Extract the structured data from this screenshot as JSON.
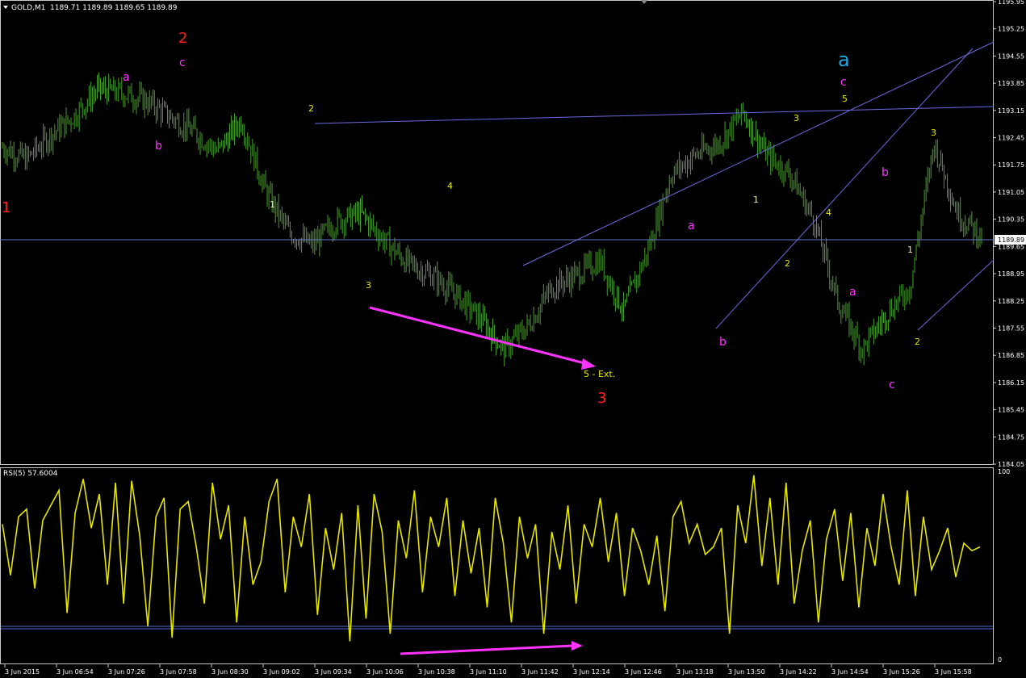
{
  "window": {
    "symbol_label": "GOLD,M1",
    "ohlc_label": "1189.71 1189.89 1189.65 1189.89",
    "indicator_label": "RSI(5) 57.6004"
  },
  "colors": {
    "background": "#000000",
    "frame": "#ffffff",
    "bars": "#4a9e2e",
    "trendline": "#6a6adf",
    "price_line": "#6a7acc",
    "rsi_line": "#e6e600",
    "rsi_level": "#4b6bd8",
    "count_yellow": "#e6e600",
    "count_magenta": "#ff33ff",
    "count_red": "#ff2222",
    "count_cyan": "#22a7e6",
    "count_white": "#e6e6b0",
    "arrow": "#ff33ff"
  },
  "price_axis": {
    "labels": [
      "1195.95",
      "1195.25",
      "1194.55",
      "1193.85",
      "1193.15",
      "1192.45",
      "1191.75",
      "1191.05",
      "1190.35",
      "1189.65",
      "1188.95",
      "1188.25",
      "1187.55",
      "1186.85",
      "1186.15",
      "1185.45",
      "1184.75",
      "1184.05"
    ],
    "current_price": "1189.89"
  },
  "rsi_axis": {
    "top": "100",
    "bottom": "0",
    "levels": [
      15,
      18
    ]
  },
  "time_axis": {
    "labels": [
      "3 Jun 2015",
      "3 Jun 06:54",
      "3 Jun 07:26",
      "3 Jun 07:58",
      "3 Jun 08:30",
      "3 Jun 09:02",
      "3 Jun 09:34",
      "3 Jun 10:06",
      "3 Jun 10:38",
      "3 Jun 11:10",
      "3 Jun 11:42",
      "3 Jun 12:14",
      "3 Jun 12:46",
      "3 Jun 13:18",
      "3 Jun 13:50",
      "3 Jun 14:22",
      "3 Jun 14:54",
      "3 Jun 15:26",
      "3 Jun 15:58"
    ]
  },
  "chart_data": [
    {
      "type": "line",
      "title": "GOLD,M1",
      "ylim": [
        1184.05,
        1195.95
      ],
      "x": [
        "06:22",
        "06:54",
        "07:10",
        "07:26",
        "07:42",
        "07:58",
        "08:14",
        "08:30",
        "08:46",
        "09:02",
        "09:18",
        "09:34",
        "09:50",
        "10:06",
        "10:22",
        "10:38",
        "10:54",
        "11:10",
        "11:26",
        "11:42",
        "11:58",
        "12:14",
        "12:30",
        "12:46",
        "13:02",
        "13:18",
        "13:34",
        "13:50",
        "14:06",
        "14:22",
        "14:38",
        "14:54",
        "15:02",
        "15:10",
        "15:18",
        "15:26",
        "15:34",
        "15:42",
        "15:50",
        "15:58",
        "16:06",
        "16:14"
      ],
      "series": [
        {
          "values": [
            1192.2,
            1191.9,
            1192.5,
            1193.0,
            1193.7,
            1193.6,
            1193.4,
            1193.0,
            1192.6,
            1192.1,
            1192.9,
            1191.1,
            1190.0,
            1189.7,
            1190.3,
            1190.5,
            1189.8,
            1189.2,
            1188.9,
            1188.4,
            1187.8,
            1187.0,
            1187.6,
            1188.6,
            1188.9,
            1189.3,
            1188.0,
            1189.5,
            1191.5,
            1192.0,
            1192.3,
            1193.1,
            1192.0,
            1191.5,
            1190.3,
            1188.2,
            1187.0,
            1187.9,
            1188.6,
            1192.3,
            1190.5,
            1189.9
          ]
        }
      ],
      "annotations": [
        {
          "text": "1",
          "x": "06:22",
          "y": 1190.5,
          "color": "red"
        },
        {
          "text": "2",
          "x": "07:58",
          "y": 1195.0,
          "color": "red"
        },
        {
          "text": "c",
          "x": "07:58",
          "y": 1194.5,
          "color": "magenta"
        },
        {
          "text": "a",
          "x": "07:42",
          "y": 1194.0,
          "color": "magenta"
        },
        {
          "text": "b",
          "x": "08:30",
          "y": 1192.3,
          "color": "magenta"
        },
        {
          "text": "1",
          "x": "09:18",
          "y": 1190.8,
          "color": "white"
        },
        {
          "text": "2",
          "x": "09:34",
          "y": 1193.4,
          "color": "yellow"
        },
        {
          "text": "3",
          "x": "10:06",
          "y": 1188.6,
          "color": "yellow"
        },
        {
          "text": "4",
          "x": "11:10",
          "y": 1191.4,
          "color": "yellow"
        },
        {
          "text": "5 - Ext.",
          "x": "12:14",
          "y": 1186.5,
          "color": "yellow"
        },
        {
          "text": "3",
          "x": "12:14",
          "y": 1185.9,
          "color": "red"
        },
        {
          "text": "a",
          "x": "13:18",
          "y": 1189.9,
          "color": "magenta"
        },
        {
          "text": "b",
          "x": "13:34",
          "y": 1187.2,
          "color": "magenta"
        },
        {
          "text": "1",
          "x": "13:50",
          "y": 1190.9,
          "color": "white"
        },
        {
          "text": "2",
          "x": "14:06",
          "y": 1188.9,
          "color": "yellow"
        },
        {
          "text": "3",
          "x": "14:22",
          "y": 1193.0,
          "color": "yellow"
        },
        {
          "text": "4",
          "x": "14:38",
          "y": 1190.6,
          "color": "yellow"
        },
        {
          "text": "5",
          "x": "14:54",
          "y": 1193.6,
          "color": "yellow"
        },
        {
          "text": "c",
          "x": "14:54",
          "y": 1193.9,
          "color": "magenta"
        },
        {
          "text": "a",
          "x": "14:54",
          "y": 1194.4,
          "color": "cyan"
        },
        {
          "text": "b",
          "x": "15:26",
          "y": 1191.7,
          "color": "magenta"
        },
        {
          "text": "a",
          "x": "14:54",
          "y": 1188.6,
          "color": "magenta"
        },
        {
          "text": "c",
          "x": "15:26",
          "y": 1186.3,
          "color": "magenta"
        },
        {
          "text": "1",
          "x": "15:34",
          "y": 1189.6,
          "color": "white"
        },
        {
          "text": "2",
          "x": "15:42",
          "y": 1187.3,
          "color": "yellow"
        },
        {
          "text": "3",
          "x": "15:58",
          "y": 1192.6,
          "color": "yellow"
        }
      ]
    },
    {
      "type": "line",
      "title": "RSI(5) 57.6004",
      "ylim": [
        0,
        100
      ],
      "series": [
        {
          "values": [
            72,
            45,
            76,
            80,
            38,
            74,
            82,
            90,
            25,
            78,
            96,
            70,
            88,
            40,
            94,
            30,
            95,
            66,
            18,
            76,
            86,
            12,
            80,
            84,
            60,
            30,
            94,
            64,
            82,
            20,
            76,
            40,
            52,
            84,
            96,
            36,
            76,
            60,
            88,
            24,
            70,
            48,
            78,
            10,
            82,
            22,
            88,
            68,
            14,
            74,
            54,
            90,
            36,
            76,
            60,
            86,
            34,
            74,
            46,
            70,
            28,
            86,
            62,
            20,
            76,
            54,
            72,
            14,
            68,
            48,
            82,
            30,
            72,
            60,
            86,
            52,
            78,
            34,
            70,
            58,
            40,
            66,
            26,
            76,
            84,
            62,
            72,
            56,
            60,
            70,
            14,
            82,
            62,
            98,
            50,
            86,
            40,
            94,
            30,
            58,
            74,
            20,
            64,
            80,
            42,
            78,
            28,
            70,
            50,
            88,
            60,
            40,
            90,
            34,
            76,
            48,
            58,
            70,
            44,
            62,
            58,
            60
          ]
        }
      ]
    }
  ]
}
